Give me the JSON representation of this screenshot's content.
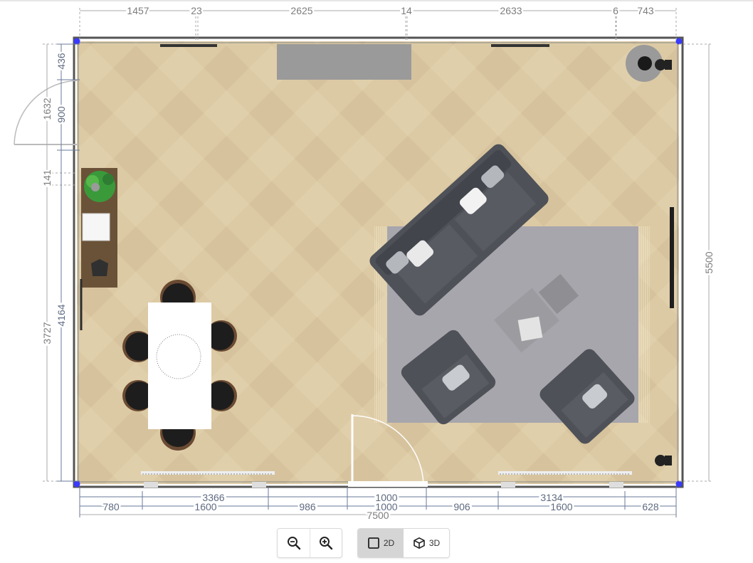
{
  "colors": {
    "dimension_line": "#9a9a9a",
    "dimension_text": "#5f6b80",
    "wall": "#545454",
    "floor": "#dccaa4",
    "rug": "#a7a6ad",
    "sofa": "#4f5158",
    "vertex_dot": "#3a3aff",
    "toolbar_active": "#d5d5d5"
  },
  "dimensions": {
    "top": [
      "1457",
      "23",
      "2625",
      "14",
      "2633",
      "6",
      "743"
    ],
    "left_outer": [
      "1632",
      "141",
      "3727"
    ],
    "left_inner": [
      "436",
      "900",
      "4164"
    ],
    "right": "5500",
    "bottom_row1": [
      "3366",
      "1000",
      "3134"
    ],
    "bottom_row2": [
      "780",
      "1600",
      "986",
      "1000",
      "906",
      "1600",
      "628"
    ],
    "bottom_total": "7500"
  },
  "toolbar": {
    "zoom_out_icon": "zoom-out-icon",
    "zoom_in_icon": "zoom-in-icon",
    "view_2d_label": "2D",
    "view_3d_label": "3D",
    "active_view": "2D"
  }
}
